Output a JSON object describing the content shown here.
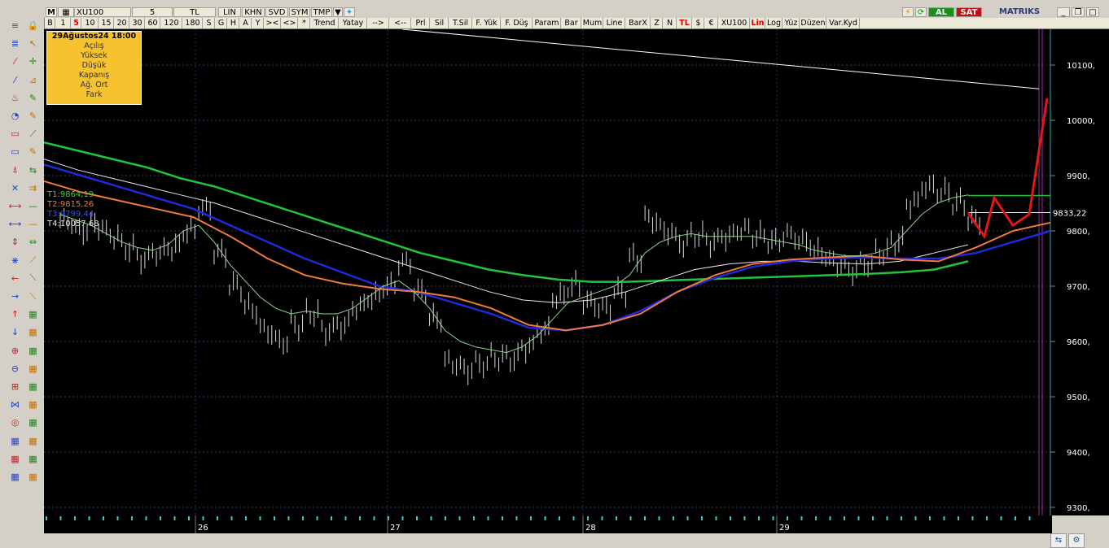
{
  "header": {
    "symbol": "XU100",
    "period": "5",
    "currency": "TL",
    "buttons": [
      "LIN",
      "KHN",
      "SVD",
      "SYM",
      "TMP"
    ],
    "al": "AL",
    "sat": "SAT",
    "brand": "MATRIKS"
  },
  "toolbar": {
    "items": [
      "B",
      "1",
      "5",
      "10",
      "15",
      "20",
      "30",
      "60",
      "120",
      "180",
      "S",
      "G",
      "H",
      "A",
      "Y",
      "><",
      "<>",
      "*",
      "Trend",
      "Yatay",
      "-->",
      "<--",
      "Prl",
      "Sil",
      "T.Sil",
      "F. Yük",
      "F. Düş",
      "Param",
      "Bar",
      "Mum",
      "Line",
      "BarX",
      "Z",
      "N",
      "TL",
      "$",
      "€",
      "XU100",
      "Lin",
      "Log",
      "Yüz",
      "Düzen",
      "Var.Kyd"
    ]
  },
  "infobox": {
    "date": "29Ağustos24 18:00",
    "rows": [
      "Açılış",
      "Yüksek",
      "Düşük",
      "Kapanış",
      "Ağ. Ort",
      "Fark"
    ]
  },
  "targets": {
    "t1": "T1:9864,19",
    "t2": "T2:9815,26",
    "t3": "T3:9799,44",
    "t4": "T4:10057,68"
  },
  "colors": {
    "ma_green": "#22c43a",
    "ma_white": "#e8e8e8",
    "ma_blue": "#1d2bd8",
    "ma_orange": "#f07a3a",
    "ma_thin_green": "#8fd08f",
    "projection": "#e01818"
  },
  "chart_data": {
    "type": "line",
    "ylim": [
      9300,
      10150
    ],
    "y_ticks": [
      "10100,",
      "10000,",
      "9900,",
      "9800,",
      "9700,",
      "9600,",
      "9500,",
      "9400,",
      "9300,"
    ],
    "x_labels": [
      "26",
      "27",
      "28",
      "29"
    ],
    "last_price_label": "9833,22",
    "series": [
      {
        "name": "price",
        "values": [
          9815,
          9800,
          9810,
          9790,
          9770,
          9750,
          9760,
          9770,
          9800,
          9840,
          9760,
          9700,
          9660,
          9620,
          9600,
          9630,
          9650,
          9620,
          9630,
          9660,
          9680,
          9700,
          9740,
          9690,
          9640,
          9560,
          9550,
          9560,
          9570,
          9570,
          9590,
          9620,
          9680,
          9700,
          9670,
          9660,
          9690,
          9750,
          9820,
          9800,
          9780,
          9790,
          9780,
          9790,
          9800,
          9790,
          9780,
          9790,
          9780,
          9760,
          9740,
          9730,
          9740,
          9760,
          9780,
          9850,
          9880,
          9870,
          9850,
          9820
        ]
      },
      {
        "name": "ma_thin",
        "values": [
          9830,
          9820,
          9810,
          9795,
          9780,
          9770,
          9765,
          9775,
          9800,
          9810,
          9780,
          9740,
          9710,
          9680,
          9660,
          9650,
          9655,
          9650,
          9650,
          9660,
          9680,
          9700,
          9710,
          9690,
          9660,
          9620,
          9600,
          9590,
          9585,
          9580,
          9590,
          9610,
          9640,
          9670,
          9680,
          9690,
          9700,
          9720,
          9760,
          9780,
          9790,
          9795,
          9790,
          9790,
          9790,
          9790,
          9785,
          9780,
          9775,
          9765,
          9760,
          9755,
          9755,
          9760,
          9770,
          9800,
          9830,
          9850,
          9860,
          9865
        ]
      }
    ],
    "projection": [
      9833,
      9790,
      9860,
      9810,
      9830,
      10040
    ]
  },
  "bottom": {
    "scroll_hint": ""
  }
}
